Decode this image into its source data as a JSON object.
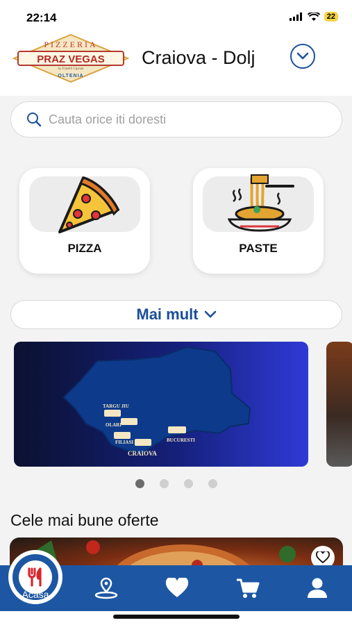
{
  "status": {
    "time": "22:14",
    "battery": "22"
  },
  "header": {
    "logo": {
      "line1": "PIZZERIA",
      "line2": "PRAZ VEGAS",
      "tagline": "by Fratelli Ciprian",
      "line3": "OLTENIA"
    },
    "city": "Craiova - Dolj"
  },
  "search": {
    "placeholder": "Cauta orice iti doresti"
  },
  "categories": [
    {
      "label": "PIZZA",
      "icon": "pizza-slice-icon"
    },
    {
      "label": "PASTE",
      "icon": "spaghetti-plate-icon"
    }
  ],
  "more_button": {
    "label": "Mai mult"
  },
  "banner": {
    "cities": [
      "TARGU JIU",
      "OLARI",
      "FILIASI",
      "CRAIOVA",
      "BUCURESTI"
    ],
    "carousel": {
      "count": 4,
      "active": 0
    }
  },
  "offers": {
    "title": "Cele mai bune oferte"
  },
  "nav": {
    "items": [
      {
        "label": "Acasa",
        "icon": "fork-knife-icon"
      },
      {
        "label": "",
        "icon": "map-pin-icon"
      },
      {
        "label": "",
        "icon": "heart-icon"
      },
      {
        "label": "",
        "icon": "cart-icon"
      },
      {
        "label": "",
        "icon": "user-icon"
      }
    ]
  },
  "colors": {
    "brand_blue": "#1d57a3",
    "accent_red": "#d8262e",
    "battery_yellow": "#f4d443"
  }
}
